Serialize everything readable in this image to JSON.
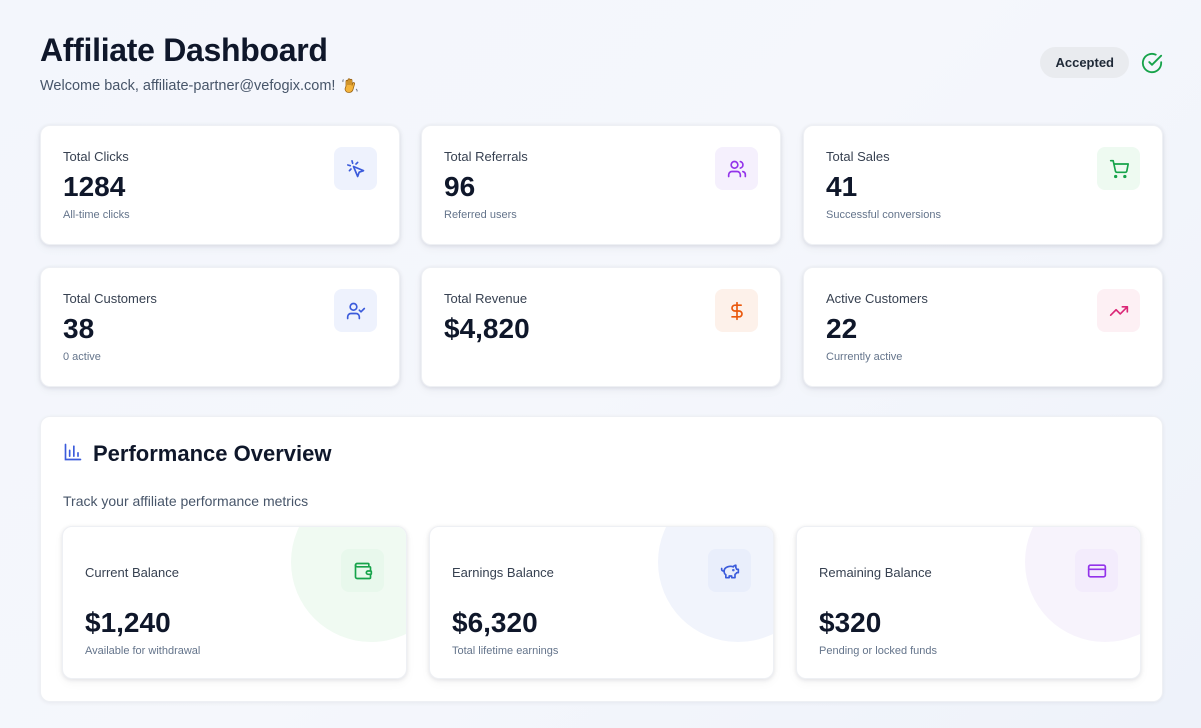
{
  "header": {
    "title": "Affiliate Dashboard",
    "welcome": "Welcome back, affiliate-partner@vefogix.com!",
    "status": "Accepted"
  },
  "stats": [
    {
      "label": "Total Clicks",
      "value": "1284",
      "sub": "All-time clicks",
      "icon": "cursor-click-icon",
      "color": "#3b5bdb"
    },
    {
      "label": "Total Referrals",
      "value": "96",
      "sub": "Referred users",
      "icon": "users-icon",
      "color": "#9333ea"
    },
    {
      "label": "Total Sales",
      "value": "41",
      "sub": "Successful conversions",
      "icon": "shopping-cart-icon",
      "color": "#16a34a"
    },
    {
      "label": "Total Customers",
      "value": "38",
      "sub": "0 active",
      "icon": "user-check-icon",
      "color": "#3b5bdb"
    },
    {
      "label": "Total Revenue",
      "value": "$4,820",
      "sub": "",
      "icon": "dollar-icon",
      "color": "#ea580c"
    },
    {
      "label": "Active Customers",
      "value": "22",
      "sub": "Currently active",
      "icon": "trending-up-icon",
      "color": "#db2777"
    }
  ],
  "performance": {
    "title": "Performance Overview",
    "subtitle": "Track your affiliate performance metrics",
    "balances": [
      {
        "label": "Current Balance",
        "value": "$1,240",
        "sub": "Available for withdrawal",
        "icon": "wallet-icon",
        "color": "#16a34a"
      },
      {
        "label": "Earnings Balance",
        "value": "$6,320",
        "sub": "Total lifetime earnings",
        "icon": "piggy-bank-icon",
        "color": "#3b5bdb"
      },
      {
        "label": "Remaining Balance",
        "value": "$320",
        "sub": "Pending or locked funds",
        "icon": "credit-card-icon",
        "color": "#9333ea"
      }
    ]
  }
}
